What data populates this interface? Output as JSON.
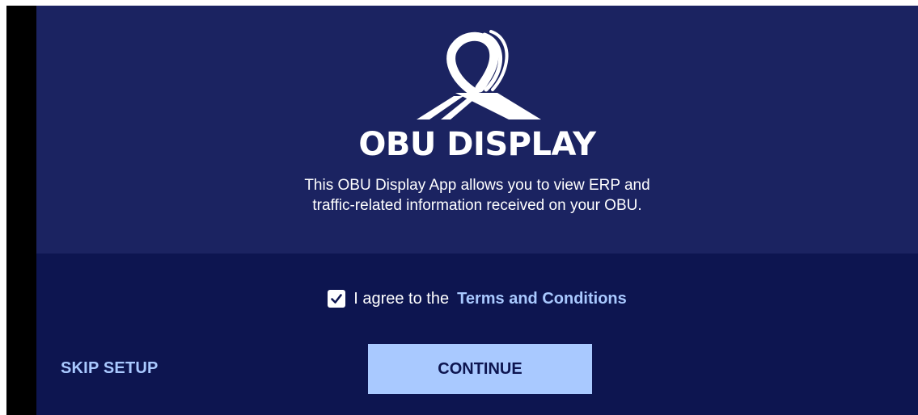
{
  "app": {
    "title": "OBU DISPLAY",
    "description_line1": "This OBU Display App allows you to view ERP and",
    "description_line2": "traffic-related information received on your OBU.",
    "logo_icon": "obu-display-logo-icon"
  },
  "agreement": {
    "checked": true,
    "text": "I agree to the",
    "link_label": "Terms and Conditions"
  },
  "actions": {
    "skip_label": "SKIP SETUP",
    "continue_label": "CONTINUE"
  },
  "colors": {
    "background_top": "#1b2361",
    "background_bottom": "#0d1550",
    "accent": "#a9c9ff",
    "text": "#ffffff"
  }
}
